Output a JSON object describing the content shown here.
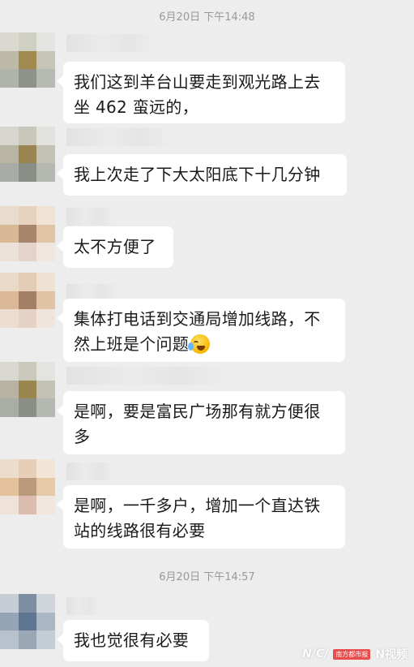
{
  "timestamps": [
    "6月20日 下午14:48",
    "6月20日 下午14:57"
  ],
  "messages": [
    {
      "text": "我们这到羊台山要走到观光路上去坐462蛮远的，"
    },
    {
      "text": "我上次走了下大太阳底下十几分钟"
    },
    {
      "text": "太不方便了"
    },
    {
      "text": "集体打电话到交通局增加线路，不然上班是个问题"
    },
    {
      "text": "是啊，要是富民广场那有就方便很多"
    },
    {
      "text": "是啊，一千多户，增加一个直达铁站的线路很有必要"
    },
    {
      "text": "我也觉很有必要"
    }
  ],
  "message_lines": {
    "m1": [
      "我们这到羊台山要走到观光路上去",
      "坐 462 蛮远的，"
    ],
    "m2": [
      "我上次走了下大太阳底下十几分钟"
    ],
    "m3": [
      "太不方便了"
    ],
    "m4": [
      "集体打电话到交通局增加线路，不",
      "然上班是个问题"
    ],
    "m5": [
      "是啊，要是富民广场那有就方便很",
      "多"
    ],
    "m6": [
      "是啊，一千多户，增加一个直达铁",
      "站的线路很有必要"
    ],
    "m7": [
      "我也觉很有必要"
    ]
  },
  "emoji": "crying-laughing-emoji",
  "watermark": {
    "logo": "N/C/",
    "badge": "南方都市报",
    "brand": "N视频"
  },
  "colors": {
    "background": "#ededed",
    "bubble": "#ffffff",
    "timestamp": "#999999"
  }
}
